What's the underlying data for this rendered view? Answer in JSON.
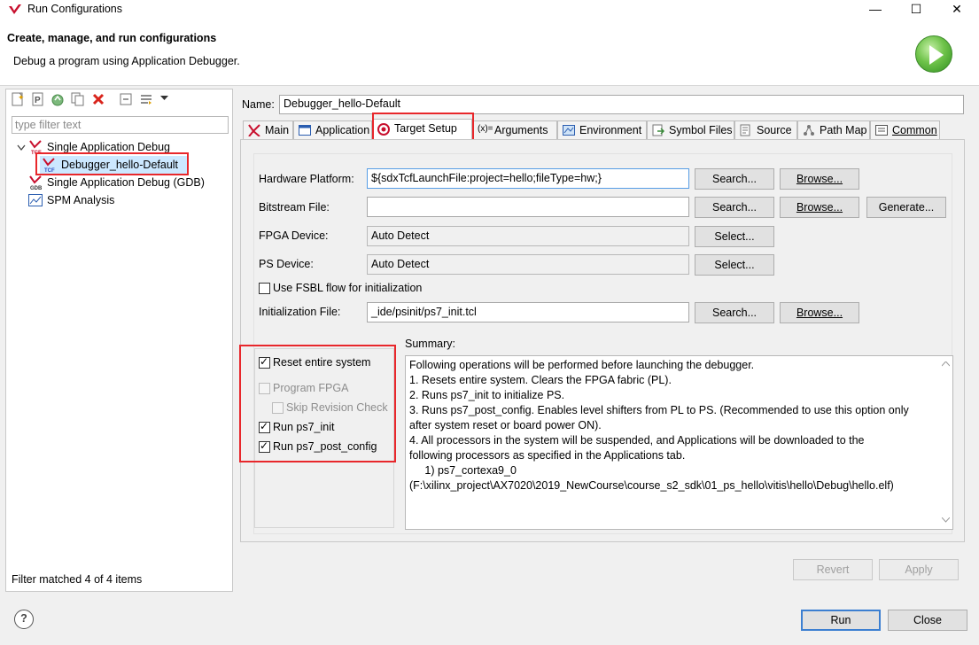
{
  "window": {
    "title": "Run Configurations",
    "controls": {
      "minimize": "—",
      "maximize": "☐",
      "close": "✕"
    }
  },
  "header": {
    "title": "Create, manage, and run configurations",
    "description": "Debug a program using Application Debugger."
  },
  "left": {
    "filter_placeholder": "type filter text",
    "tree": [
      {
        "label": "Single Application Debug",
        "icon": "xilinx-tcf-icon"
      },
      {
        "label": "Debugger_hello-Default",
        "icon": "xilinx-tcf-icon"
      },
      {
        "label": "Single Application Debug (GDB)",
        "icon": "xilinx-gdb-icon"
      },
      {
        "label": "SPM Analysis",
        "icon": "spm-chart-icon"
      }
    ],
    "status": "Filter matched 4 of 4 items"
  },
  "config": {
    "name_label": "Name:",
    "name_value": "Debugger_hello-Default",
    "tabs": [
      {
        "label": "Main",
        "icon": "xilinx-icon"
      },
      {
        "label": "Application",
        "icon": "window-icon"
      },
      {
        "label": "Target Setup",
        "icon": "target-icon"
      },
      {
        "label": "Arguments",
        "icon": "arguments-icon"
      },
      {
        "label": "Environment",
        "icon": "environment-icon"
      },
      {
        "label": "Symbol Files",
        "icon": "symbol-files-icon"
      },
      {
        "label": "Source",
        "icon": "source-icon"
      },
      {
        "label": "Path Map",
        "icon": "path-map-icon"
      },
      {
        "label": "Common",
        "icon": "common-icon"
      }
    ],
    "active_tab": "Target Setup"
  },
  "target": {
    "hw_platform_label": "Hardware Platform:",
    "hw_platform_value": "${sdxTcfLaunchFile:project=hello;fileType=hw;}",
    "bitstream_label": "Bitstream File:",
    "bitstream_value": "",
    "fpga_label": "FPGA Device:",
    "fpga_value": "Auto Detect",
    "ps_label": "PS Device:",
    "ps_value": "Auto Detect",
    "fsbl_label": "Use FSBL flow for initialization",
    "fsbl_checked": false,
    "init_label": "Initialization File:",
    "init_value": "_ide/psinit/ps7_init.tcl",
    "search": "Search...",
    "browse": "Browse...",
    "generate": "Generate...",
    "select": "Select..."
  },
  "options": {
    "reset": {
      "label": "Reset entire system",
      "checked": true
    },
    "program_fpga": {
      "label": "Program FPGA",
      "checked": false,
      "enabled": false
    },
    "skip_revision": {
      "label": "Skip Revision Check",
      "checked": false,
      "enabled": false
    },
    "run_init": {
      "label": "Run ps7_init",
      "checked": true
    },
    "run_post": {
      "label": "Run ps7_post_config",
      "checked": true
    }
  },
  "summary": {
    "label": "Summary:",
    "lines": [
      "Following operations will be performed before launching the debugger.",
      "1. Resets entire system. Clears the FPGA fabric (PL).",
      "2. Runs ps7_init to initialize PS.",
      "3. Runs ps7_post_config. Enables level shifters from PL to PS. (Recommended to use this option only",
      "after system reset or board power ON).",
      "4. All processors in the system will be suspended, and Applications will be downloaded to the",
      "following processors as specified in the Applications tab.",
      "     1) ps7_cortexa9_0",
      "(F:\\xilinx_project\\AX7020\\2019_NewCourse\\course_s2_sdk\\01_ps_hello\\vitis\\hello\\Debug\\hello.elf)"
    ]
  },
  "footer": {
    "revert": "Revert",
    "apply": "Apply",
    "run": "Run",
    "close": "Close",
    "help": "?"
  },
  "colors": {
    "highlight": "#e8272b",
    "accent": "#3c7fd1",
    "xilinx_red": "#c8102e"
  }
}
